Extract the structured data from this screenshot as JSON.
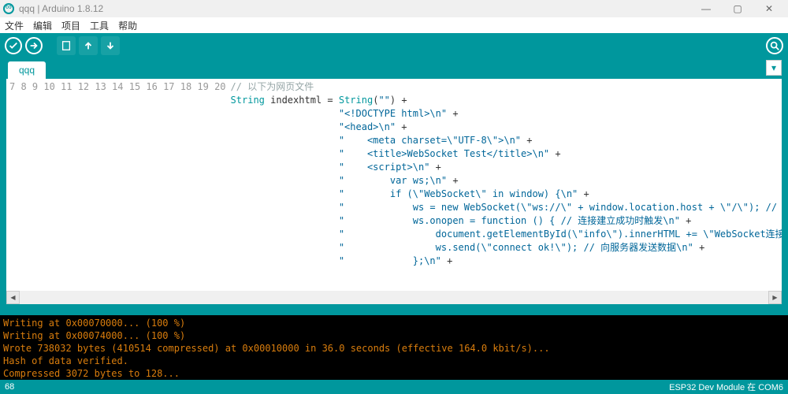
{
  "titlebar": {
    "title": "qqq | Arduino 1.8.12"
  },
  "menu": {
    "file": "文件",
    "edit": "编辑",
    "sketch": "项目",
    "tools": "工具",
    "help": "帮助"
  },
  "tab": {
    "name": "qqq"
  },
  "gutter_start": 7,
  "gutter_end": 20,
  "code_lines": [
    [
      [
        "cmt",
        "// 以下为网页文件"
      ]
    ],
    [
      [
        "kw",
        "String"
      ],
      [
        "plain",
        " indexhtml "
      ],
      [
        "plain",
        "="
      ],
      [
        "plain",
        " "
      ],
      [
        "kw",
        "String"
      ],
      [
        "plain",
        "("
      ],
      [
        "str",
        "\"\""
      ],
      [
        "plain",
        ") "
      ],
      [
        "plain",
        "+"
      ]
    ],
    [
      [
        "plain",
        "                   "
      ],
      [
        "str",
        "\"<!DOCTYPE html>\\n\""
      ],
      [
        "plain",
        " +"
      ]
    ],
    [
      [
        "plain",
        "                   "
      ],
      [
        "str",
        "\"<head>\\n\""
      ],
      [
        "plain",
        " +"
      ]
    ],
    [
      [
        "plain",
        "                   "
      ],
      [
        "str",
        "\"    <meta charset=\\\"UTF-8\\\">\\n\""
      ],
      [
        "plain",
        " +"
      ]
    ],
    [
      [
        "plain",
        "                   "
      ],
      [
        "str",
        "\"    <title>WebSocket Test</title>\\n\""
      ],
      [
        "plain",
        " +"
      ]
    ],
    [
      [
        "plain",
        "                   "
      ],
      [
        "str",
        "\"    <script>\\n\""
      ],
      [
        "plain",
        " +"
      ]
    ],
    [
      [
        "plain",
        "                   "
      ],
      [
        "str",
        "\"        var ws;\\n\""
      ],
      [
        "plain",
        " +"
      ]
    ],
    [
      [
        "plain",
        "                   "
      ],
      [
        "str",
        "\"        if (\\\"WebSocket\\\" in window) {\\n\""
      ],
      [
        "plain",
        " +"
      ]
    ],
    [
      [
        "plain",
        "                   "
      ],
      [
        "str",
        "\"            ws = new WebSocket(\\\"ws://\\\" + window.location.host + \\\"/\\\"); // 建立WebSocket连接\\n\""
      ],
      [
        "plain",
        " +"
      ]
    ],
    [
      [
        "plain",
        "                   "
      ],
      [
        "str",
        "\"            ws.onopen = function () { // 连接建立成功时触发\\n\""
      ],
      [
        "plain",
        " +"
      ]
    ],
    [
      [
        "plain",
        "                   "
      ],
      [
        "str",
        "\"                document.getElementById(\\\"info\\\").innerHTML += \\\"WebSocket连接成功！\\\" + \\\"<br>\\\";\\n\""
      ],
      [
        "plain",
        " +"
      ]
    ],
    [
      [
        "plain",
        "                   "
      ],
      [
        "str",
        "\"                ws.send(\\\"connect ok!\\\"); // 向服务器发送数据\\n\""
      ],
      [
        "plain",
        " +"
      ]
    ],
    [
      [
        "plain",
        "                   "
      ],
      [
        "str",
        "\"            };\\n\""
      ],
      [
        "plain",
        " +"
      ]
    ]
  ],
  "console_lines": [
    "Writing at 0x00070000... (100 %)",
    "Writing at 0x00074000... (100 %)",
    "Wrote 738032 bytes (410514 compressed) at 0x00010000 in 36.0 seconds (effective 164.0 kbit/s)...",
    "Hash of data verified.",
    "Compressed 3072 bytes to 128..."
  ],
  "status": {
    "left": "68",
    "right": "ESP32 Dev Module 在 COM6"
  },
  "window_controls": {
    "min": "—",
    "max": "▢",
    "close": "✕"
  }
}
